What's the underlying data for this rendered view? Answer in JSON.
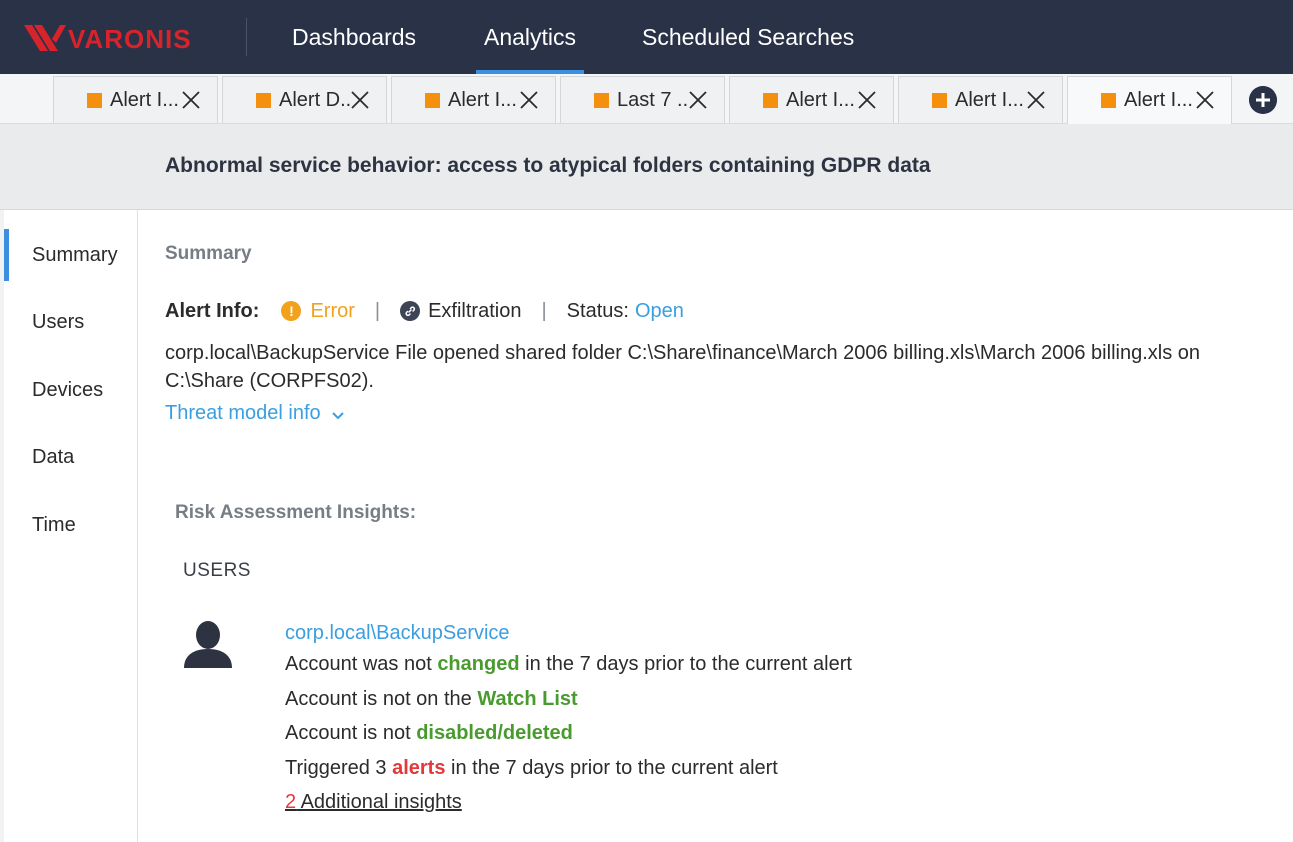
{
  "colors": {
    "nav_bg": "#293246",
    "accent": "#3a8fe0",
    "link": "#3a9ee0",
    "warning": "#f2a11c",
    "ok": "#4a9b2f",
    "danger": "#e2393b",
    "tab_marker": "#f5900e"
  },
  "brand": {
    "name": "VARONIS"
  },
  "nav": {
    "items": [
      {
        "label": "Dashboards",
        "active": false
      },
      {
        "label": "Analytics",
        "active": true
      },
      {
        "label": "Scheduled Searches",
        "active": false
      }
    ]
  },
  "tabs": [
    {
      "label": "Alert I..."
    },
    {
      "label": "Alert D..."
    },
    {
      "label": "Alert I..."
    },
    {
      "label": "Last 7 ..."
    },
    {
      "label": "Alert I..."
    },
    {
      "label": "Alert I..."
    },
    {
      "label": "Alert I...",
      "active": true
    }
  ],
  "title": "Abnormal service behavior: access to atypical folders containing GDPR data",
  "sidenav": {
    "items": [
      {
        "label": "Summary",
        "active": true
      },
      {
        "label": "Users"
      },
      {
        "label": "Devices"
      },
      {
        "label": "Data"
      },
      {
        "label": "Time"
      }
    ]
  },
  "summary": {
    "heading": "Summary",
    "alert_info": {
      "label": "Alert Info:",
      "severity": "Error",
      "severity_icon": "exclamation-circle-icon",
      "category": "Exfiltration",
      "category_icon": "link-icon",
      "status_label": "Status:",
      "status_value": "Open"
    },
    "description": "corp.local\\BackupService File opened shared folder C:\\Share\\finance\\March 2006 billing.xls\\March 2006 billing.xls on C:\\Share (CORPFS02).",
    "threat_link": "Threat model info"
  },
  "risk": {
    "heading": "Risk Assessment Insights:",
    "users_heading": "USERS",
    "user": {
      "name": "corp.local\\BackupService",
      "avatar_icon": "user-icon",
      "insights": [
        {
          "pre": "Account was not ",
          "hl": "changed",
          "post": " in the 7 days prior to the current alert",
          "tone": "ok"
        },
        {
          "pre": "Account is not on the ",
          "hl": "Watch List",
          "post": "",
          "tone": "ok"
        },
        {
          "pre": "Account is not ",
          "hl": "disabled/deleted",
          "post": "",
          "tone": "ok"
        },
        {
          "pre": "Triggered 3 ",
          "hl": "alerts",
          "post": " in the 7 days prior to the current alert",
          "tone": "danger"
        }
      ],
      "more_count": "2",
      "more_label": " Additional insights"
    }
  }
}
